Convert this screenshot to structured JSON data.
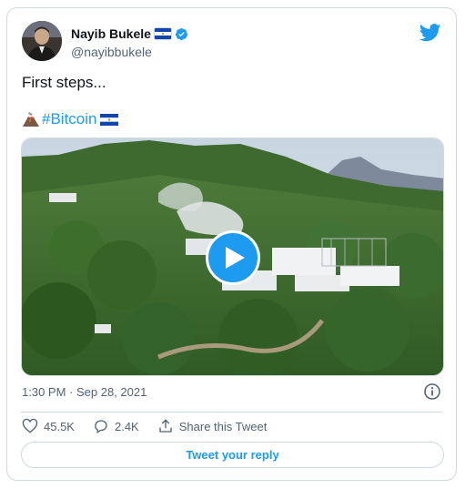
{
  "author": {
    "name": "Nayib Bukele",
    "handle": "@nayibbukele",
    "verified": true,
    "flag_icon": "el-salvador-flag-icon"
  },
  "tweet": {
    "line1": "First steps...",
    "volcano_emoji": "volcano-icon",
    "hashtag": "#Bitcoin",
    "trailing_flag": "el-salvador-flag-icon"
  },
  "media": {
    "type": "video",
    "play_icon": "play-icon"
  },
  "meta": {
    "timestamp": "1:30 PM · Sep 28, 2021",
    "info_icon": "info-icon"
  },
  "actions": {
    "likes": "45.5K",
    "replies": "2.4K",
    "share_label": "Share this Tweet"
  },
  "reply_button": "Tweet your reply",
  "colors": {
    "accent": "#1d9bf0",
    "text": "#0f1419",
    "secondary": "#536471",
    "border": "#cfd9de"
  }
}
